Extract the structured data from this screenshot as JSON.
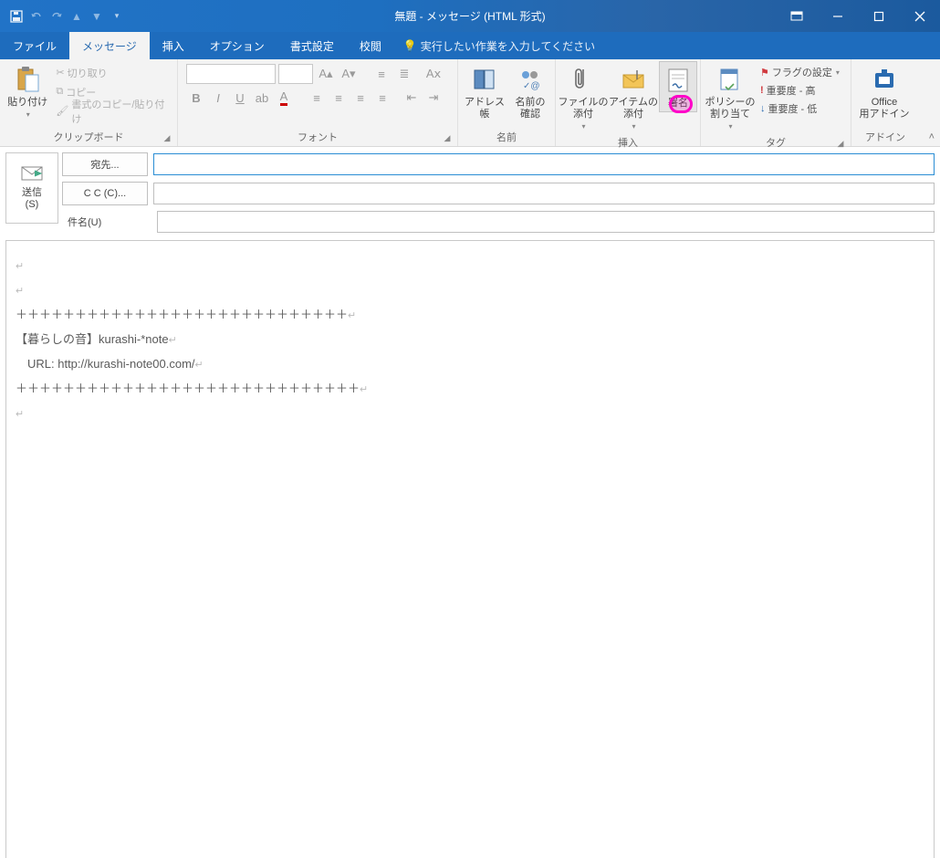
{
  "title": "無題  -  メッセージ (HTML 形式)",
  "qat": {
    "save": "save-icon",
    "undo": "undo-icon",
    "redo": "redo-icon",
    "up": "up-icon",
    "down": "down-icon",
    "more": "more-icon"
  },
  "tabs": {
    "file": "ファイル",
    "message": "メッセージ",
    "insert": "挿入",
    "options": "オプション",
    "format": "書式設定",
    "review": "校閲",
    "tell": "実行したい作業を入力してください"
  },
  "ribbon": {
    "clipboard": {
      "label": "クリップボード",
      "paste": "貼り付け",
      "cut": "切り取り",
      "copy": "コピー",
      "formatPainter": "書式のコピー/貼り付け"
    },
    "font": {
      "label": "フォント"
    },
    "names": {
      "label": "名前",
      "addressBook": "アドレス帳",
      "checkNames": "名前の\n確認"
    },
    "include": {
      "label": "挿入",
      "attachFile": "ファイルの\n添付",
      "attachItem": "アイテムの\n添付",
      "signature": "署名"
    },
    "tags": {
      "label": "タグ",
      "policy": "ポリシーの\n割り当て",
      "followUp": "フラグの設定",
      "highImp": "重要度 - 高",
      "lowImp": "重要度 - 低"
    },
    "addins": {
      "label": "アドイン",
      "office": "Office\n用アドイン"
    }
  },
  "header": {
    "send": "送信\n(S)",
    "to": "宛先...",
    "cc": "C C (C)...",
    "subject": "件名(U)"
  },
  "body": {
    "l1": "",
    "l2": "",
    "l3": "＋＋＋＋＋＋＋＋＋＋＋＋＋＋＋＋＋＋＋＋＋＋＋＋＋＋＋＋",
    "l4": "【暮らしの音】kurashi-*note",
    "l5": "　URL: http://kurashi-note00.com/",
    "l6": "＋＋＋＋＋＋＋＋＋＋＋＋＋＋＋＋＋＋＋＋＋＋＋＋＋＋＋＋＋",
    "l7": ""
  }
}
